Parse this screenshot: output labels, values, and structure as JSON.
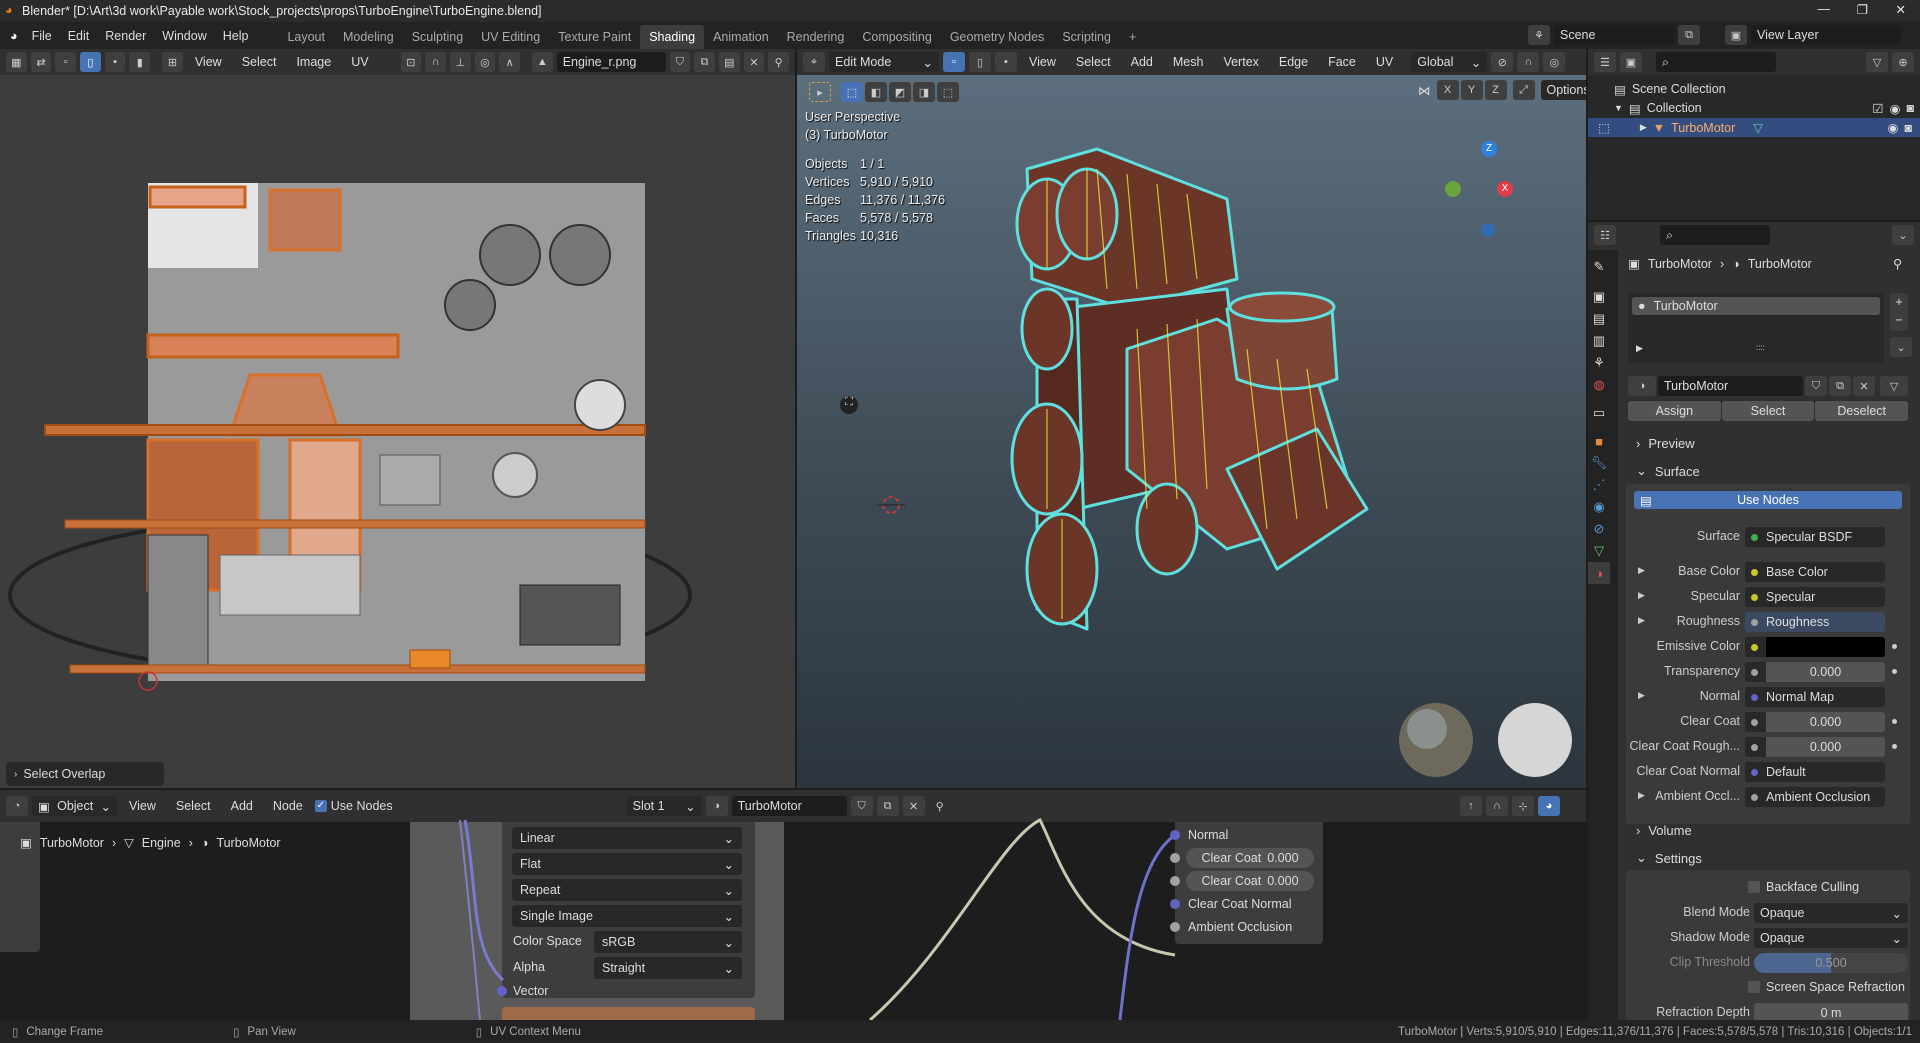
{
  "title": "Blender* [D:\\Art\\3d work\\Payable work\\Stock_projects\\props\\TurboEngine\\TurboEngine.blend]",
  "menu": [
    "File",
    "Edit",
    "Render",
    "Window",
    "Help"
  ],
  "workspaces": [
    "Layout",
    "Modeling",
    "Sculpting",
    "UV Editing",
    "Texture Paint",
    "Shading",
    "Animation",
    "Rendering",
    "Compositing",
    "Geometry Nodes",
    "Scripting"
  ],
  "add_workspace": "+",
  "scene": "Scene",
  "view_layer": "View Layer",
  "image_editor": {
    "menu": [
      "View",
      "Select",
      "Image",
      "UV"
    ],
    "image_name": "Engine_r.png",
    "select_overlap": "Select Overlap"
  },
  "viewport": {
    "mode": "Edit Mode",
    "menu": [
      "View",
      "Select",
      "Add",
      "Mesh",
      "Vertex",
      "Edge",
      "Face",
      "UV"
    ],
    "orientation": "Global",
    "axes": [
      "X",
      "Y",
      "Z"
    ],
    "options": "Options",
    "view_name": "User Perspective",
    "object_label": "(3) TurboMotor",
    "stats": [
      {
        "label": "Objects",
        "value": "1 / 1"
      },
      {
        "label": "Vertices",
        "value": "5,910 / 5,910"
      },
      {
        "label": "Edges",
        "value": "11,376 / 11,376"
      },
      {
        "label": "Faces",
        "value": "5,578 / 5,578"
      },
      {
        "label": "Triangles",
        "value": "10,316"
      }
    ],
    "gizmo": {
      "z": "Z",
      "x": "X"
    }
  },
  "outliner": {
    "items": [
      "Scene Collection",
      "Collection",
      "TurboMotor"
    ]
  },
  "properties": {
    "breadcrumb": [
      "TurboMotor",
      "TurboMotor"
    ],
    "slot": "TurboMotor",
    "material": "TurboMotor",
    "assign": "Assign",
    "select": "Select",
    "deselect": "Deselect",
    "preview": "Preview",
    "surface_panel": "Surface",
    "use_nodes": "Use Nodes",
    "rows": [
      {
        "label": "Surface",
        "value": "Specular BSDF",
        "dot": "#3fb34a"
      },
      {
        "label": "Base Color",
        "value": "Base Color",
        "dot": "#c7c729"
      },
      {
        "label": "Specular",
        "value": "Specular",
        "dot": "#c7c729"
      },
      {
        "label": "Roughness",
        "value": "Roughness",
        "dot": "#a1a1a1"
      },
      {
        "label": "Emissive Color",
        "value": "",
        "dot": "#c7c729"
      },
      {
        "label": "Transparency",
        "value": "0.000",
        "dot": "#a1a1a1"
      },
      {
        "label": "Normal",
        "value": "Normal Map",
        "dot": "#6363c7"
      },
      {
        "label": "Clear Coat",
        "value": "0.000",
        "dot": "#a1a1a1"
      },
      {
        "label": "Clear Coat Rough...",
        "value": "0.000",
        "dot": "#a1a1a1"
      },
      {
        "label": "Clear Coat Normal",
        "value": "Default",
        "dot": "#6363c7"
      },
      {
        "label": "Ambient Occl...",
        "value": "Ambient Occlusion",
        "dot": "#a1a1a1"
      }
    ],
    "volume": "Volume",
    "settings": "Settings",
    "backface": "Backface Culling",
    "blend_label": "Blend Mode",
    "blend_value": "Opaque",
    "shadow_label": "Shadow Mode",
    "shadow_value": "Opaque",
    "clip_label": "Clip Threshold",
    "clip_value": "0.500",
    "clip_fraction": 0.5,
    "ssr": "Screen Space Refraction",
    "refraction_label": "Refraction Depth",
    "refraction_value": "0 m"
  },
  "node_editor": {
    "mode": "Object",
    "menu": [
      "View",
      "Select",
      "Add",
      "Node"
    ],
    "use_nodes": "Use Nodes",
    "slot": "Slot 1",
    "material": "TurboMotor",
    "breadcrumb": [
      "TurboMotor",
      "Engine",
      "TurboMotor"
    ],
    "image_node": {
      "interpolation": "Linear",
      "projection": "Flat",
      "extension": "Repeat",
      "source": "Single Image",
      "color_space_label": "Color Space",
      "color_space": "sRGB",
      "alpha_label": "Alpha",
      "alpha": "Straight",
      "vector": "Vector"
    },
    "bsdf_node": {
      "normal": "Normal",
      "clear_coat": "Clear Coat",
      "clear_coat_value": "0.000",
      "clear_coat2": "Clear Coat",
      "clear_coat2_value": "0.000",
      "clear_coat_normal": "Clear Coat Normal",
      "ambient_occlusion": "Ambient Occlusion"
    }
  },
  "status": {
    "left": [
      "Change Frame",
      "Pan View",
      "UV Context Menu"
    ],
    "right": "TurboMotor | Verts:5,910/5,910 | Edges:11,376/11,376 | Faces:5,578/5,578 | Tris:10,316 | Objects:1/1"
  },
  "colors": {
    "accent": "#4772b3",
    "selection": "#334d80",
    "wire": "#5fe0e0",
    "uv": "#d86f2a"
  }
}
